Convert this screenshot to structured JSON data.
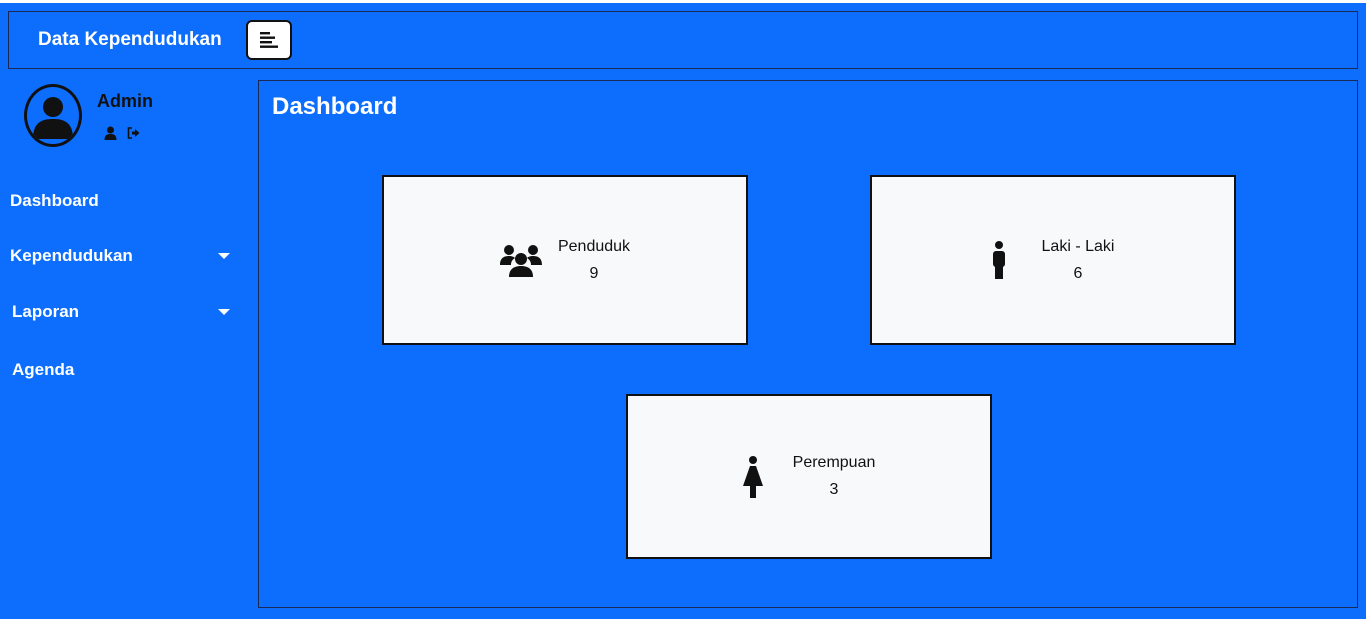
{
  "header": {
    "brand": "Data Kependudukan",
    "toggle_icon": "menu-lines-icon"
  },
  "profile": {
    "name": "Admin",
    "avatar_icon": "user-avatar-icon",
    "actions": [
      "user-icon",
      "logout-icon"
    ]
  },
  "sidebar": {
    "items": [
      {
        "label": "Dashboard",
        "has_caret": false
      },
      {
        "label": "Kependudukan",
        "has_caret": true
      },
      {
        "label": "Laporan",
        "has_caret": true
      },
      {
        "label": "Agenda",
        "has_caret": false
      }
    ]
  },
  "main": {
    "title": "Dashboard",
    "cards": [
      {
        "label": "Penduduk",
        "value": "9",
        "icon": "users-group-icon"
      },
      {
        "label": "Laki - Laki",
        "value": "6",
        "icon": "male-icon"
      },
      {
        "label": "Perempuan",
        "value": "3",
        "icon": "female-icon"
      }
    ]
  },
  "colors": {
    "background": "#0d6efd",
    "card": "#f8f9fa",
    "border": "#111111",
    "text_light": "#ffffff"
  }
}
